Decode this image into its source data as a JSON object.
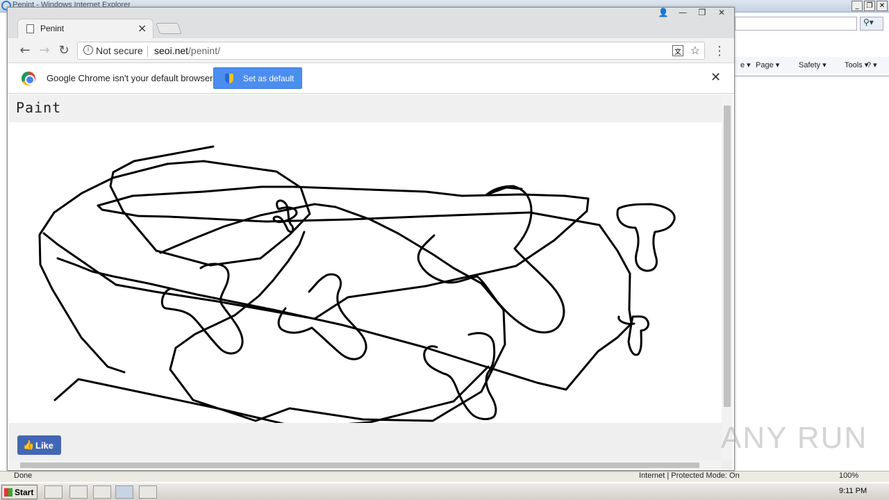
{
  "ie": {
    "title": "Penint - Windows Internet Explorer",
    "commands": [
      "Page ▾",
      "Safety ▾",
      "Tools ▾",
      "? ▾"
    ],
    "status_text": "Done",
    "zone_text": "Internet | Protected Mode: On",
    "zoom": "100%"
  },
  "chrome": {
    "tab_title": "Penint",
    "security_label": "Not secure",
    "url_host": "seoi.net",
    "url_path": "/penint/",
    "infobar_text": "Google Chrome isn't your default browser",
    "set_default_label": "Set as default"
  },
  "page": {
    "title": "Paint",
    "like_label": "Like"
  },
  "taskbar": {
    "start_label": "Start",
    "clock": "9:11 PM"
  },
  "watermark": "ANY RUN"
}
